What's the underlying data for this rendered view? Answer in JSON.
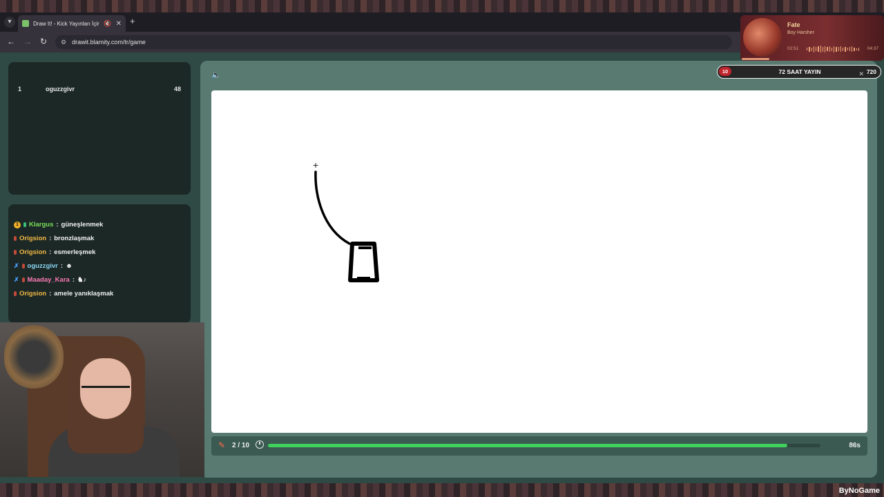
{
  "browser": {
    "tab_title": "Draw It! - Kick Yayınları İçin",
    "tab_mute_icon": "speaker-muted-icon",
    "url": "drawit.blamity.com/tr/game"
  },
  "leaderboard": {
    "rows": [
      {
        "rank": "1",
        "name": "oguzzgivr",
        "score": "48"
      }
    ]
  },
  "chat": {
    "messages": [
      {
        "user": "Klargus",
        "text": "güneşlenmek",
        "color": "#7be05a"
      },
      {
        "user": "Origsion",
        "text": "bronzlaşmak",
        "color": "#f2b844"
      },
      {
        "user": "Origsion",
        "text": "esmerleşmek",
        "color": "#f2b844"
      },
      {
        "user": "oguzzgivr",
        "text": "",
        "color": "#8ad4f0"
      },
      {
        "user": "Maaday_Kara",
        "text": "",
        "color": "#ff7ab6"
      },
      {
        "user": "Origsion",
        "text": "amele yanıklaşmak",
        "color": "#f2b844"
      }
    ]
  },
  "game": {
    "round": "2 / 10",
    "time_left": "86s",
    "timer_progress": 0.94,
    "accent_color": "#3fd15b"
  },
  "subathon": {
    "left_value": "10",
    "title": "72 SAAT YAYIN",
    "right_value": "720"
  },
  "music": {
    "title": "Fate",
    "artist": "Boy Harsher",
    "elapsed": "02:51",
    "total": "04:37"
  },
  "watermark": "ByNoGame"
}
